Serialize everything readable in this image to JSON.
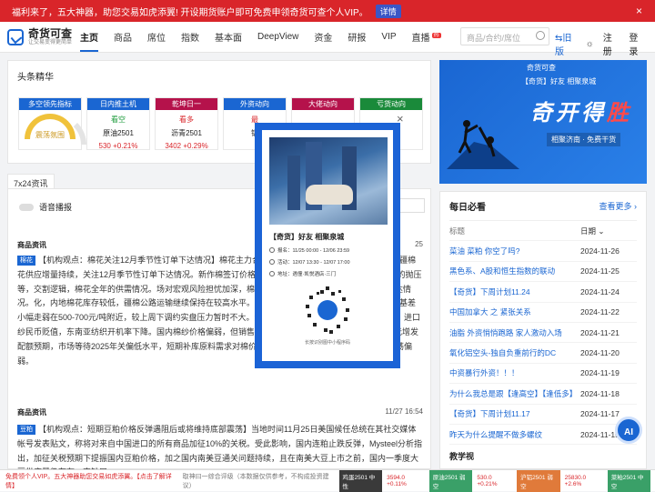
{
  "banner": {
    "text": "福利来了，五大神器，助您交易如虎添翼! 开设期货账户即可免费申领奇货可查个人VIP。",
    "detail": "详情",
    "close": "×"
  },
  "logo": {
    "title": "奇货可查",
    "subtitle": "让交易变得更简单"
  },
  "nav": {
    "items": [
      "主页",
      "商品",
      "指数",
      "基本面",
      "DeepView",
      "资金",
      "研报",
      "VIP",
      "直播"
    ],
    "pinned": "席位",
    "hot": "热",
    "search_placeholder": "商品/合约/席位",
    "old": "旧版",
    "login": "登录",
    "register": "注册"
  },
  "headline": {
    "title": "头条精华"
  },
  "cards": [
    {
      "head": "多空领先指标",
      "color": "#1a66d2",
      "gauge_label": "震荡氛围"
    },
    {
      "head": "日内推土机",
      "color": "#1a66d2",
      "l1": "看空",
      "l2": "原油2501",
      "l3": "530 +0.21%",
      "c1": "#1a9a3a",
      "c3": "#d9252a"
    },
    {
      "head": "乾坤日一",
      "color": "#b5124b",
      "l1": "看多",
      "l2": "沥青2501",
      "l3": "3402 +0.29%",
      "c1": "#d9252a",
      "c3": "#d9252a"
    },
    {
      "head": "外资动向",
      "color": "#1a66d2",
      "l1": "最",
      "l2": "铝",
      "l3": ""
    },
    {
      "head": "大佬动向",
      "color": "#b5124b",
      "l1": "",
      "l2": "",
      "l3": ""
    },
    {
      "head": "亏货动向",
      "color": "#1a8a3a",
      "l1": "",
      "l2": "",
      "l3": ""
    }
  ],
  "feed": {
    "tab": "7x24资讯",
    "broadcast": "语音播报",
    "items": [
      {
        "section": "商品资讯",
        "time": "25",
        "tag": "棉花",
        "text": "【机构观点：棉花关注12月季节性订单下达情况】棉花主力合约震荡整理，持仓偏弱于近期，国内新疆棉花供应增量持续，关注12月季节性订单下达情况。新作棉签订价格偏弱。点：供 中国市场，以及棉纱市场的抛压等，交割逻辑，棉花全年的供需情况。场对宏观风险担忧加深，棉价偏弱震荡。需关注12月季节性订单下达情况。化，内地棉花库存较低，疆棉公路运输继续保持在较高水平。据国家统计局数据，200万吨。现货销售基差小幅走弱在500-700元/吨附近，较上周下调约实盘压力暂时不大。进口棉花榨：中性 进口纱进口库存不高，进口纱民币贬值，东南亚纺织开机率下降。国内棉纱价格偏弱，但销售尚可。业：保税区棉花库存较高，但暂无增发配额预期，市场等待2025年关偏低水平，短期补库原料需求对棉价形成支撑。下游订单暂无起色，短期震荡偏弱。"
      },
      {
        "section": "商品资讯",
        "time": "11/27 16:54",
        "tag": "豆粕",
        "text": "【机构观点：短期豆粕价格反弹遇阻后或将维持底部震荡】当地时间11月25日美国候任总统在其社交媒体帐号发表贴文，称将对来自中国进口的所有商品加征10%的关税。受此影响，国内连粕止跌反弹，Mysteel分析指出，加征关税预期下提振国内豆粕价格，加之国内南美豆通关问题持续，且在南美大豆上市之前，国内一季度大豆供应量仍存在一定缺口"
      }
    ]
  },
  "ad": {
    "brand": "奇货可查",
    "tag": "【奇货】好友 相聚泉城",
    "big1": "奇开得",
    "big2": "胜",
    "sub": "相聚济南 · 免费干货"
  },
  "overlay": {
    "title": "【奇货】好友 相聚泉城",
    "signup": "报名：11/25 00:00 - 12/06 23:59",
    "event": "活动：12/07 13:30 - 12/07 17:00",
    "address": "地址：遇僮·凯悦酒店·三门",
    "caption": "长按识别图中小程序码",
    "close": "×"
  },
  "recommend": {
    "title": "每日必看",
    "more": "查看更多 ›",
    "col1": "标题",
    "col2": "日期 ⌄",
    "rows": [
      {
        "t": "菜油 菜粕 你空了吗?",
        "d": "2024-11-26"
      },
      {
        "t": "黑色系、A股和恒生指数的联动",
        "d": "2024-11-25"
      },
      {
        "t": "【奇货】下周计划11.24",
        "d": "2024-11-24"
      },
      {
        "t": "中国加拿大 之 紧张关系",
        "d": "2024-11-22"
      },
      {
        "t": "油脂 外资悄悄跑路 家人激动入场",
        "d": "2024-11-21"
      },
      {
        "t": "氧化铝空头-独自负重前行的DC",
        "d": "2024-11-20"
      },
      {
        "t": "中资暴行外资！！！",
        "d": "2024-11-19"
      },
      {
        "t": "为什么我总是跟【逢高空】【逢低多】",
        "d": "2024-11-18"
      },
      {
        "t": "【奇货】下周计划11.17",
        "d": "2024-11-17"
      },
      {
        "t": "昨天为什么提醒不做多螺纹",
        "d": "2024-11-15"
      }
    ],
    "next": "教学视"
  },
  "ai": "AI",
  "footer": {
    "promo": "免费领个人VIP。五大神器助您交易如虎添翼。【点击了解详情】",
    "note": "取神曰一综合评级（本数据仅供参考，不构成投资建议）",
    "tickers": [
      {
        "name": "鸡蛋2501 中性",
        "val": "3594.0 +0.11%",
        "nc": "#3a3a3a"
      },
      {
        "name": "原油2501 弱空",
        "val": "530.0 +0.21%",
        "nc": "#3aa068"
      },
      {
        "name": "沪铝2501 弱空",
        "val": "25830.0 +2.6%",
        "nc": "#e07a3a"
      },
      {
        "name": "菜粕2501 中空",
        "val": "",
        "nc": "#3aa068"
      }
    ]
  }
}
